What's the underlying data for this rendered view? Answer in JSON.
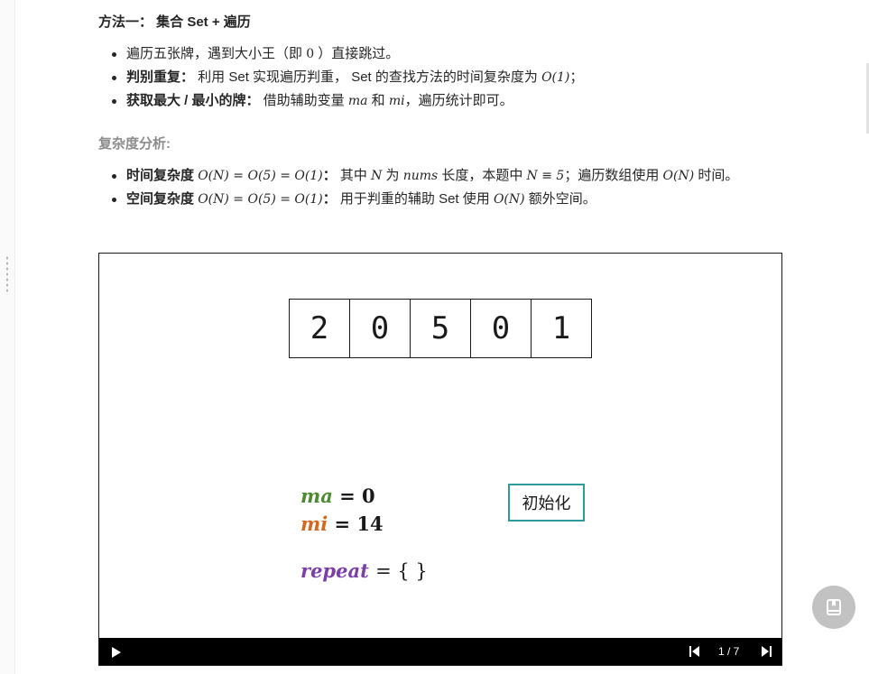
{
  "article": {
    "heading": "方法一： 集合 Set + 遍历",
    "bullets": [
      {
        "bold": "",
        "text_a": "遍历五张牌，遇到大小王（即",
        "math_a": "0",
        "text_b": "）直接跳过。"
      },
      {
        "bold": "判别重复：",
        "text_a": " 利用 Set 实现遍历判重， Set 的查找方法的时间复杂度为",
        "math_a": "O(1)",
        "text_b": "；"
      },
      {
        "bold": "获取最大 / 最小的牌：",
        "text_a": " 借助辅助变量",
        "math_a": "ma",
        "text_b": "和",
        "math_b": "mi",
        "text_c": "，遍历统计即可。"
      }
    ],
    "subheading": "复杂度分析:",
    "complexity": [
      {
        "bold": "时间复杂度",
        "math_bold": "O(N) = O(5) = O(1)",
        "bold_colon": "：",
        "text_a": " 其中",
        "math_a": "N",
        "text_b": "为",
        "math_b": "nums",
        "text_c": "长度，本题中",
        "math_c": "N ≡ 5",
        "text_d": "；遍历数组使用",
        "math_d": "O(N)",
        "text_e": "时间。"
      },
      {
        "bold": "空间复杂度",
        "math_bold": "O(N) = O(5) = O(1)",
        "bold_colon": "：",
        "text_a": " 用于判重的辅助 Set 使用",
        "math_a": "O(N)",
        "text_b": "额外空间。"
      }
    ]
  },
  "player": {
    "array": [
      "2",
      "0",
      "5",
      "0",
      "1"
    ],
    "ma": {
      "name": "ma",
      "value": "= 0"
    },
    "mi": {
      "name": "mi",
      "value": "= 14"
    },
    "repeat": {
      "name": "repeat",
      "value": "= { }"
    },
    "state_label": "初始化",
    "page_count": "1 / 7",
    "colors": {
      "ma": "#4e8a2f",
      "mi": "#d2691e",
      "repeat": "#7b3fa8",
      "state_border": "#2e9b9b"
    }
  },
  "icons": {
    "play": "play-icon",
    "prev": "skip-previous-icon",
    "next": "skip-next-icon",
    "fab": "bookmark-book-icon"
  }
}
